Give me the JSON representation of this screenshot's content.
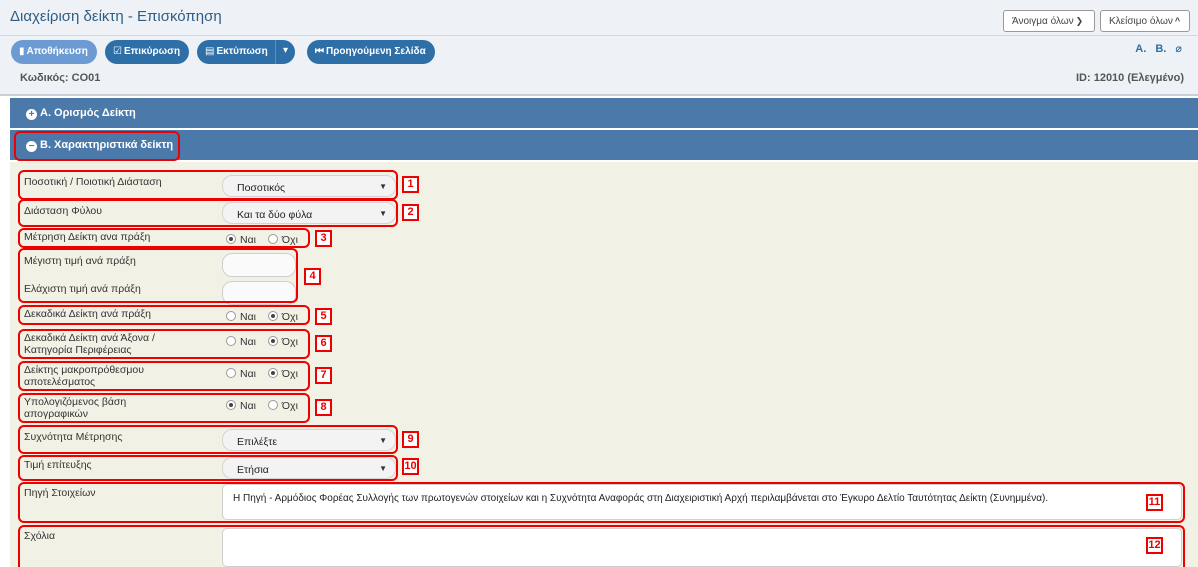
{
  "header": {
    "title": "Διαχείριση δείκτη - Επισκόπηση",
    "expand_all": "Άνοιγμα όλων",
    "collapse_all": "Κλείσιμο όλων"
  },
  "toolbar": {
    "save": "Αποθήκευση",
    "confirm": "Επικύρωση",
    "print": "Εκτύπωση",
    "previous_page": "Προηγούμενη Σελίδα",
    "link_a": "Α.",
    "link_b": "Β.",
    "code": "Κωδικός: CO01",
    "id_status": "ID: 12010 (Ελεγμένο)"
  },
  "sections": {
    "a": "Α. Ορισμός Δείκτη",
    "b": "Β. Χαρακτηριστικά δείκτη"
  },
  "radio_labels": {
    "yes": "Ναι",
    "no": "Όχι"
  },
  "fields": {
    "dimension": {
      "label": "Ποσοτική / Ποιοτική Διάσταση",
      "value": "Ποσοτικός"
    },
    "gender": {
      "label": "Διάσταση Φύλου",
      "value": "Και τα δύο φύλα"
    },
    "measure_per_action": {
      "label": "Μέτρηση Δείκτη ανα πράξη",
      "selected": "yes"
    },
    "max_value": {
      "label": "Μέγιστη τιμή ανά πράξη",
      "value": ""
    },
    "min_value": {
      "label": "Ελάχιστη τιμή ανά πράξη",
      "value": ""
    },
    "decimals_action": {
      "label": "Δεκαδικά Δείκτη ανά πράξη",
      "selected": "no"
    },
    "decimals_axis_line1": "Δεκαδικά Δείκτη ανά Άξονα /",
    "decimals_axis_line2": "Κατηγορία Περιφέρειας",
    "decimals_axis_selected": "no",
    "long_term_line1": "Δείκτης μακροπρόθεσμου",
    "long_term_line2": "αποτελέσματος",
    "long_term_selected": "no",
    "calc_census_line1": "Υπολογιζόμενος βάση",
    "calc_census_line2": "απογραφικών",
    "calc_census_selected": "yes",
    "frequency": {
      "label": "Συχνότητα Μέτρησης",
      "value": "Επιλέξτε"
    },
    "target_value": {
      "label": "Τιμή επίτευξης",
      "value": "Ετήσια"
    },
    "data_source": {
      "label": "Πηγή Στοιχείων",
      "value": "Η Πηγή - Αρμόδιος Φορέας Συλλογής των πρωτογενών στοιχείων και η Συχνότητα Αναφοράς στη Διαχειριστική Αρχή περιλαμβάνεται στο Έγκυρο Δελτίο Ταυτότητας Δείκτη (Συνημμένα)."
    },
    "comments": {
      "label": "Σχόλια",
      "value": ""
    }
  },
  "markers": [
    "1",
    "2",
    "3",
    "4",
    "5",
    "6",
    "7",
    "8",
    "9",
    "10",
    "11",
    "12"
  ],
  "colors": {
    "section_bar": "#4b7aaa",
    "button": "#2e6fa7",
    "annotation": "#e00000",
    "panel_bg": "#f2f1e6"
  }
}
